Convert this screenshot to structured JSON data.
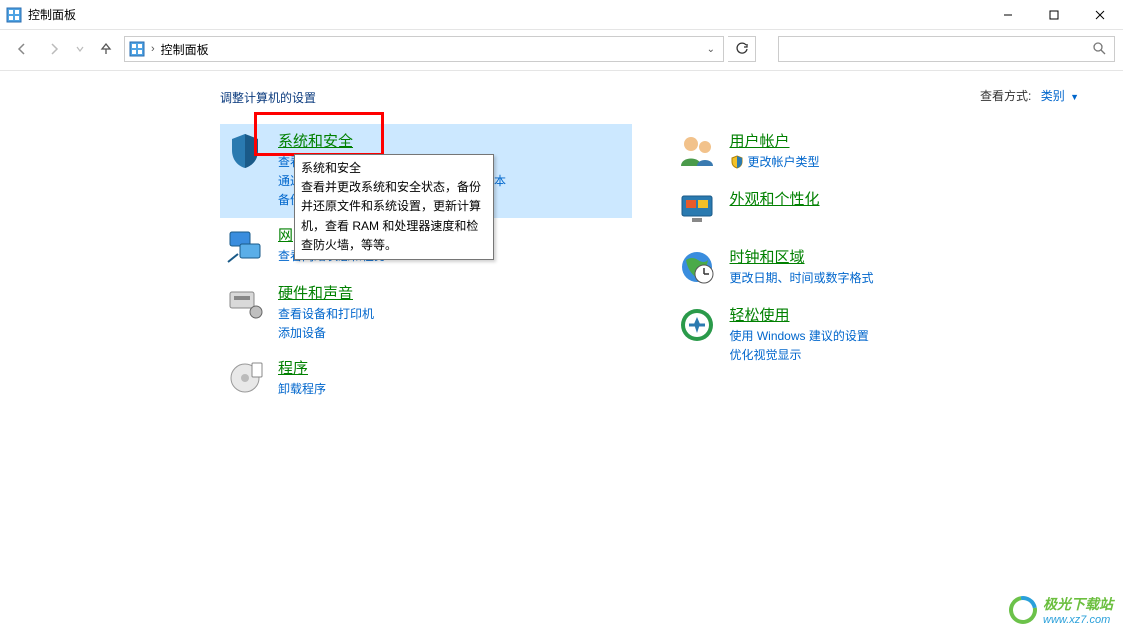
{
  "window": {
    "title": "控制面板"
  },
  "address": {
    "breadcrumb": "控制面板"
  },
  "heading": "调整计算机的设置",
  "view": {
    "label": "查看方式:",
    "value": "类别"
  },
  "red_box_target": "system-security-title",
  "tooltip": {
    "title": "系统和安全",
    "body": "查看并更改系统和安全状态，备份并还原文件和系统设置，更新计算机，查看 RAM 和处理器速度和检查防火墙，等等。"
  },
  "categories_left": [
    {
      "id": "system-security",
      "title": "系统和安全",
      "highlighted": true,
      "links": [
        {
          "text": "查看你的计算机状态",
          "shield": false,
          "obscured": true
        },
        {
          "text": "通过文件历史记录保存你的文件的备份副本",
          "shield": false,
          "obscured": true
        },
        {
          "text": "备份和还原(Windows 7)",
          "shield": false,
          "obscured": true
        }
      ]
    },
    {
      "id": "network-internet",
      "title": "网络和 Internet",
      "title_obscured_display": "网",
      "links": [
        {
          "text": "查看网络状态和任务",
          "shield": false
        }
      ]
    },
    {
      "id": "hardware-sound",
      "title": "硬件和声音",
      "links": [
        {
          "text": "查看设备和打印机",
          "shield": false
        },
        {
          "text": "添加设备",
          "shield": false
        }
      ]
    },
    {
      "id": "programs",
      "title": "程序",
      "links": [
        {
          "text": "卸载程序",
          "shield": false
        }
      ]
    }
  ],
  "categories_right": [
    {
      "id": "user-accounts",
      "title": "用户帐户",
      "links": [
        {
          "text": "更改帐户类型",
          "shield": true
        }
      ]
    },
    {
      "id": "appearance",
      "title": "外观和个性化",
      "links": []
    },
    {
      "id": "clock-region",
      "title": "时钟和区域",
      "links": [
        {
          "text": "更改日期、时间或数字格式",
          "shield": false
        }
      ]
    },
    {
      "id": "ease-of-access",
      "title": "轻松使用",
      "links": [
        {
          "text": "使用 Windows 建议的设置",
          "shield": false
        },
        {
          "text": "优化视觉显示",
          "shield": false
        }
      ]
    }
  ],
  "watermark": {
    "main": "极光下载站",
    "sub": "www.xz7.com"
  }
}
